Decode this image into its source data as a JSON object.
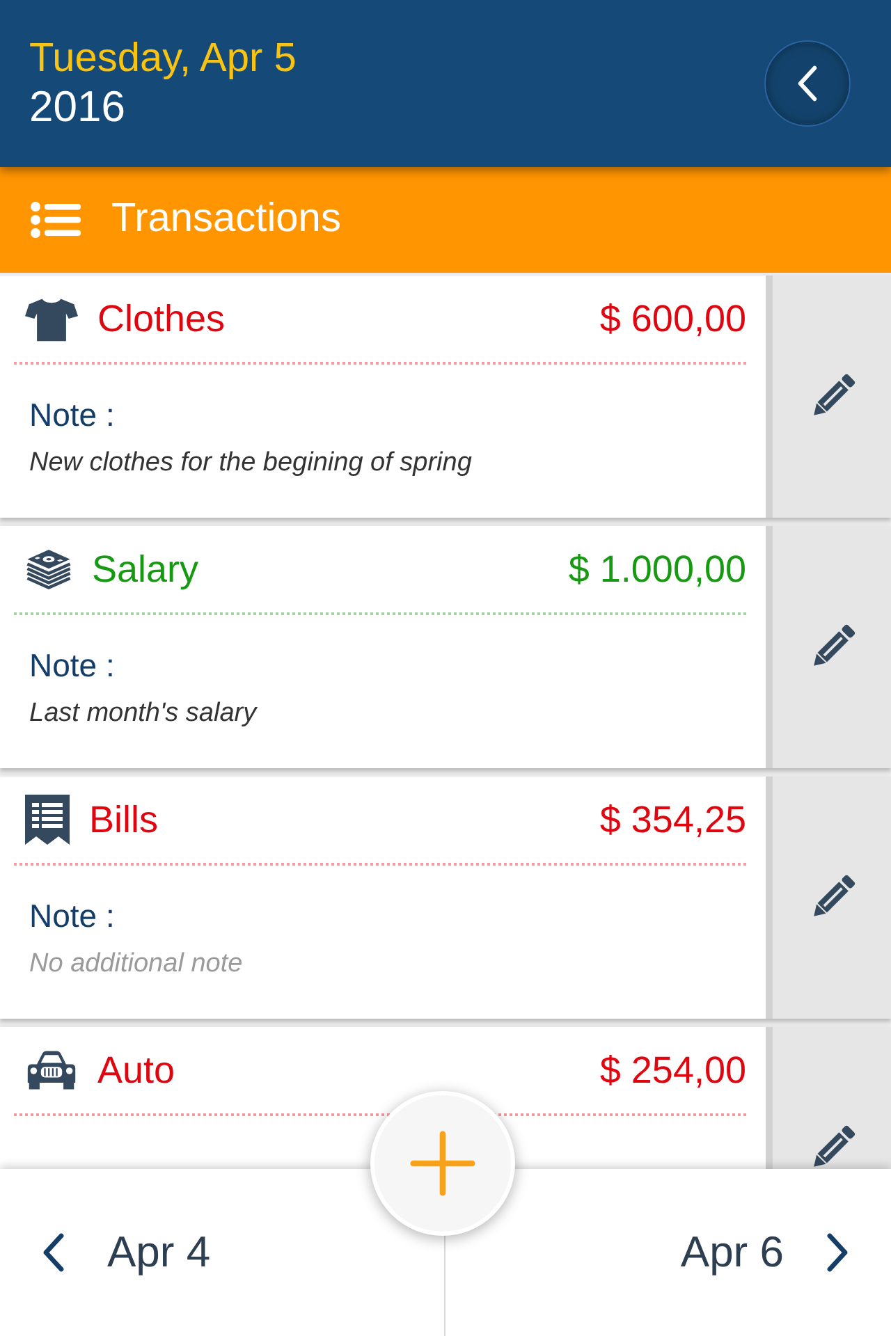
{
  "header": {
    "date": "Tuesday, Apr 5",
    "year": "2016"
  },
  "section": {
    "title": "Transactions"
  },
  "transactions": [
    {
      "kind": "clothing",
      "title": "Clothes",
      "amount": "$ 600,00",
      "color": "#e0060f",
      "note": {
        "label": "Note :",
        "text": "New clothes for the begining of spring",
        "missing": false
      }
    },
    {
      "kind": "cash",
      "title": "Salary",
      "amount": "$ 1.000,00",
      "color": "#159a12",
      "note": {
        "label": "Note :",
        "text": "Last month's salary",
        "missing": false
      }
    },
    {
      "kind": "bill",
      "title": "Bills",
      "amount": "$ 354,25",
      "color": "#e0060f",
      "note": {
        "label": "Note :",
        "text": "No additional note",
        "missing": true
      }
    },
    {
      "kind": "vehicle",
      "title": "Auto",
      "amount": "$ 254,00",
      "color": "#e0060f"
    }
  ],
  "footer": {
    "previous": "Apr 4",
    "next": "Apr 6"
  }
}
